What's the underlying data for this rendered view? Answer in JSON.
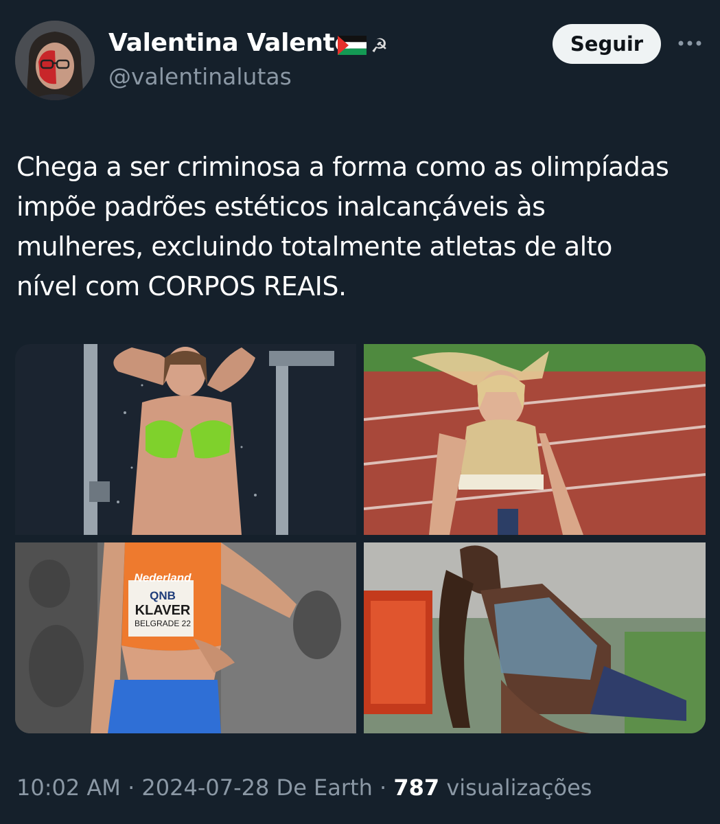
{
  "author": {
    "display_name": "Valentina Valente",
    "handle": "@valentinalutas",
    "badges": [
      "palestine-flag",
      "hammer-sickle"
    ],
    "sickle_glyph": "☭"
  },
  "actions": {
    "follow_label": "Seguir",
    "more_icon": "more-dots-icon"
  },
  "tweet": {
    "text": "Chega a ser criminosa a forma como as olimpíadas\nimpõe padrões estéticos inalcançáveis às\nmulheres, excluindo totalmente atletas de alto\nnível com CORPOS REAIS."
  },
  "media": {
    "photo_3_bib": {
      "line1": "Nederland",
      "line2": "QNB",
      "line3": "KLAVER",
      "line4": "BELGRADE 22"
    }
  },
  "meta": {
    "time": "10:02 AM",
    "sep1": " · ",
    "date": "2024-07-28",
    "source": " De Earth",
    "sep2": " · ",
    "views_count": "787",
    "views_label": " visualizações"
  },
  "colors": {
    "background": "#15202b",
    "secondary_text": "#8b98a5",
    "follow_button_bg": "#eff3f4"
  }
}
